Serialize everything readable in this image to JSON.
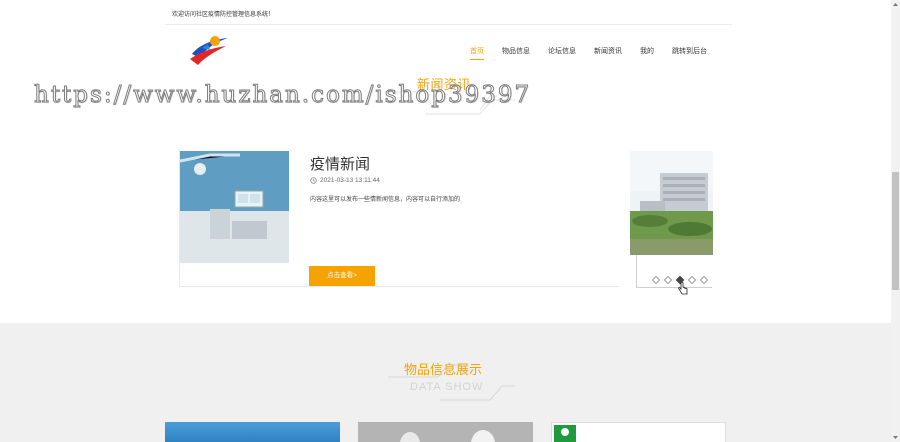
{
  "topbar": {
    "welcome": "欢迎访问社区疫情防控管理信息系统！"
  },
  "nav": {
    "items": [
      {
        "label": "首页",
        "active": true
      },
      {
        "label": "物品信息",
        "active": false
      },
      {
        "label": "论坛信息",
        "active": false
      },
      {
        "label": "新闻资讯",
        "active": false
      },
      {
        "label": "我的",
        "active": false
      },
      {
        "label": "跳转到后台",
        "active": false
      }
    ]
  },
  "news_section": {
    "title": "新闻资讯"
  },
  "watermark": "https://www.huzhan.com/ishop39397",
  "news_card": {
    "title": "疫情新闻",
    "date": "2021-03-13 13:11:44",
    "description": "内容这里可以发布一些情新闻信息，内容可以自行添加的",
    "button_label": "点击查看>"
  },
  "carousel": {
    "dots": 5,
    "active_index": 2
  },
  "products_section": {
    "title": "物品信息展示",
    "subtitle": "DATA SHOW"
  },
  "colors": {
    "accent": "#f5a300",
    "text": "#333333",
    "gray_bg": "#f0f0f0"
  },
  "icons": {
    "clock": "clock-icon",
    "cursor": "hand-cursor-icon"
  }
}
